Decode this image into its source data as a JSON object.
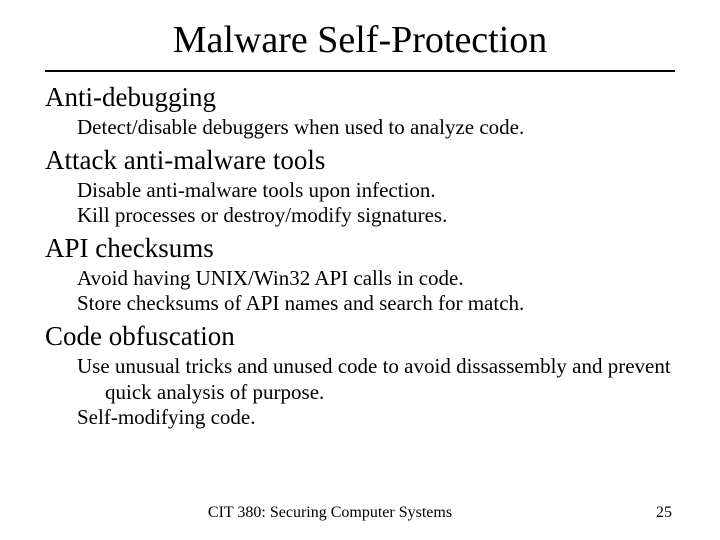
{
  "title": "Malware Self-Protection",
  "sections": [
    {
      "heading": "Anti-debugging",
      "lines": [
        "Detect/disable debuggers when used to analyze code."
      ]
    },
    {
      "heading": "Attack anti-malware tools",
      "lines": [
        "Disable anti-malware tools upon infection.",
        "Kill processes or destroy/modify signatures."
      ]
    },
    {
      "heading": "API checksums",
      "lines": [
        "Avoid having UNIX/Win32 API calls in code.",
        "Store checksums of API names and search for match."
      ]
    },
    {
      "heading": "Code obfuscation",
      "lines": [
        "Use unusual tricks and unused code to avoid dissassembly and prevent quick analysis of purpose.",
        "Self-modifying code."
      ]
    }
  ],
  "footer": {
    "course": "CIT 380: Securing Computer Systems",
    "page": "25"
  }
}
